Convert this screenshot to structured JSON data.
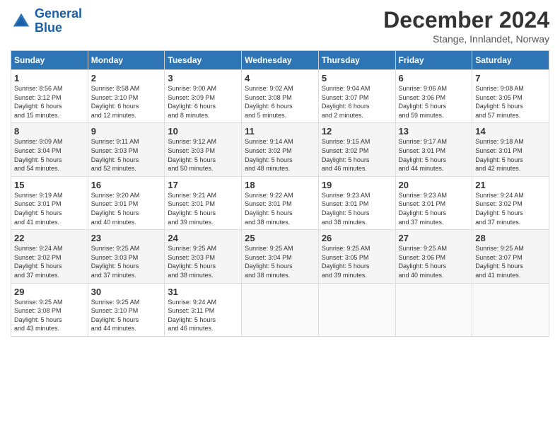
{
  "header": {
    "logo_line1": "General",
    "logo_line2": "Blue",
    "title": "December 2024",
    "subtitle": "Stange, Innlandet, Norway"
  },
  "columns": [
    "Sunday",
    "Monday",
    "Tuesday",
    "Wednesday",
    "Thursday",
    "Friday",
    "Saturday"
  ],
  "weeks": [
    [
      {
        "day": "1",
        "info": "Sunrise: 8:56 AM\nSunset: 3:12 PM\nDaylight: 6 hours\nand 15 minutes."
      },
      {
        "day": "2",
        "info": "Sunrise: 8:58 AM\nSunset: 3:10 PM\nDaylight: 6 hours\nand 12 minutes."
      },
      {
        "day": "3",
        "info": "Sunrise: 9:00 AM\nSunset: 3:09 PM\nDaylight: 6 hours\nand 8 minutes."
      },
      {
        "day": "4",
        "info": "Sunrise: 9:02 AM\nSunset: 3:08 PM\nDaylight: 6 hours\nand 5 minutes."
      },
      {
        "day": "5",
        "info": "Sunrise: 9:04 AM\nSunset: 3:07 PM\nDaylight: 6 hours\nand 2 minutes."
      },
      {
        "day": "6",
        "info": "Sunrise: 9:06 AM\nSunset: 3:06 PM\nDaylight: 5 hours\nand 59 minutes."
      },
      {
        "day": "7",
        "info": "Sunrise: 9:08 AM\nSunset: 3:05 PM\nDaylight: 5 hours\nand 57 minutes."
      }
    ],
    [
      {
        "day": "8",
        "info": "Sunrise: 9:09 AM\nSunset: 3:04 PM\nDaylight: 5 hours\nand 54 minutes."
      },
      {
        "day": "9",
        "info": "Sunrise: 9:11 AM\nSunset: 3:03 PM\nDaylight: 5 hours\nand 52 minutes."
      },
      {
        "day": "10",
        "info": "Sunrise: 9:12 AM\nSunset: 3:03 PM\nDaylight: 5 hours\nand 50 minutes."
      },
      {
        "day": "11",
        "info": "Sunrise: 9:14 AM\nSunset: 3:02 PM\nDaylight: 5 hours\nand 48 minutes."
      },
      {
        "day": "12",
        "info": "Sunrise: 9:15 AM\nSunset: 3:02 PM\nDaylight: 5 hours\nand 46 minutes."
      },
      {
        "day": "13",
        "info": "Sunrise: 9:17 AM\nSunset: 3:01 PM\nDaylight: 5 hours\nand 44 minutes."
      },
      {
        "day": "14",
        "info": "Sunrise: 9:18 AM\nSunset: 3:01 PM\nDaylight: 5 hours\nand 42 minutes."
      }
    ],
    [
      {
        "day": "15",
        "info": "Sunrise: 9:19 AM\nSunset: 3:01 PM\nDaylight: 5 hours\nand 41 minutes."
      },
      {
        "day": "16",
        "info": "Sunrise: 9:20 AM\nSunset: 3:01 PM\nDaylight: 5 hours\nand 40 minutes."
      },
      {
        "day": "17",
        "info": "Sunrise: 9:21 AM\nSunset: 3:01 PM\nDaylight: 5 hours\nand 39 minutes."
      },
      {
        "day": "18",
        "info": "Sunrise: 9:22 AM\nSunset: 3:01 PM\nDaylight: 5 hours\nand 38 minutes."
      },
      {
        "day": "19",
        "info": "Sunrise: 9:23 AM\nSunset: 3:01 PM\nDaylight: 5 hours\nand 38 minutes."
      },
      {
        "day": "20",
        "info": "Sunrise: 9:23 AM\nSunset: 3:01 PM\nDaylight: 5 hours\nand 37 minutes."
      },
      {
        "day": "21",
        "info": "Sunrise: 9:24 AM\nSunset: 3:02 PM\nDaylight: 5 hours\nand 37 minutes."
      }
    ],
    [
      {
        "day": "22",
        "info": "Sunrise: 9:24 AM\nSunset: 3:02 PM\nDaylight: 5 hours\nand 37 minutes."
      },
      {
        "day": "23",
        "info": "Sunrise: 9:25 AM\nSunset: 3:03 PM\nDaylight: 5 hours\nand 37 minutes."
      },
      {
        "day": "24",
        "info": "Sunrise: 9:25 AM\nSunset: 3:03 PM\nDaylight: 5 hours\nand 38 minutes."
      },
      {
        "day": "25",
        "info": "Sunrise: 9:25 AM\nSunset: 3:04 PM\nDaylight: 5 hours\nand 38 minutes."
      },
      {
        "day": "26",
        "info": "Sunrise: 9:25 AM\nSunset: 3:05 PM\nDaylight: 5 hours\nand 39 minutes."
      },
      {
        "day": "27",
        "info": "Sunrise: 9:25 AM\nSunset: 3:06 PM\nDaylight: 5 hours\nand 40 minutes."
      },
      {
        "day": "28",
        "info": "Sunrise: 9:25 AM\nSunset: 3:07 PM\nDaylight: 5 hours\nand 41 minutes."
      }
    ],
    [
      {
        "day": "29",
        "info": "Sunrise: 9:25 AM\nSunset: 3:08 PM\nDaylight: 5 hours\nand 43 minutes."
      },
      {
        "day": "30",
        "info": "Sunrise: 9:25 AM\nSunset: 3:10 PM\nDaylight: 5 hours\nand 44 minutes."
      },
      {
        "day": "31",
        "info": "Sunrise: 9:24 AM\nSunset: 3:11 PM\nDaylight: 5 hours\nand 46 minutes."
      },
      null,
      null,
      null,
      null
    ]
  ]
}
